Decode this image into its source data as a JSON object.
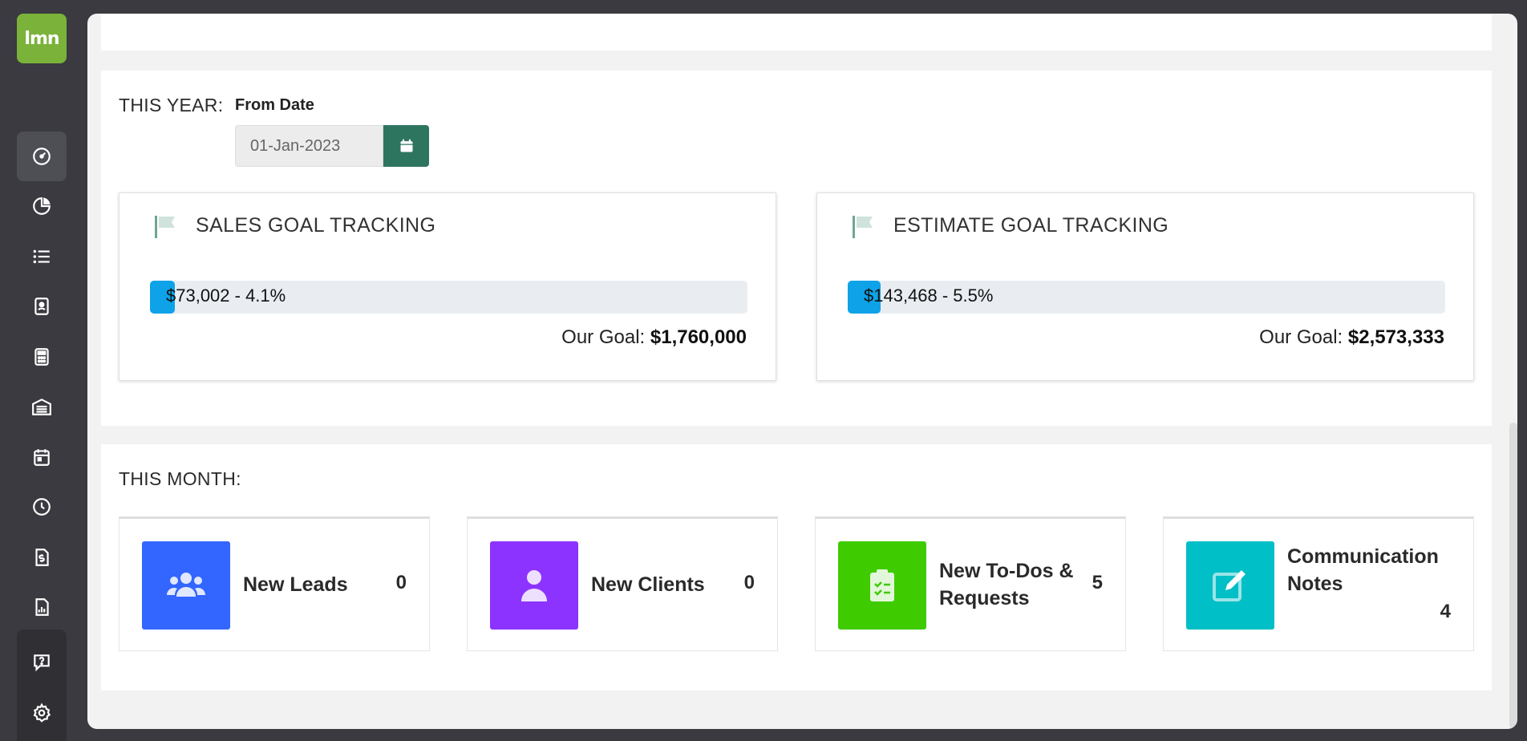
{
  "brand": {
    "logo_text": "lmn",
    "logo_color": "#7ab23a"
  },
  "sidebar": {
    "items": [
      {
        "icon": "dashboard-gauge-icon",
        "active": true
      },
      {
        "icon": "pie-chart-icon"
      },
      {
        "icon": "list-icon"
      },
      {
        "icon": "contact-card-icon"
      },
      {
        "icon": "calculator-icon"
      },
      {
        "icon": "warehouse-icon"
      },
      {
        "icon": "calendar-icon"
      },
      {
        "icon": "clock-icon"
      },
      {
        "icon": "invoice-dollar-icon"
      },
      {
        "icon": "report-chart-icon"
      },
      {
        "icon": "help-chat-icon"
      },
      {
        "icon": "settings-gear-icon"
      }
    ]
  },
  "this_year": {
    "label": "THIS YEAR:",
    "from_date_label": "From Date",
    "from_date_value": "01-Jan-2023",
    "sales": {
      "title": "SALES GOAL TRACKING",
      "progress_text": "$73,002 - 4.1%",
      "progress_fraction": 0.041,
      "goal_prefix": "Our Goal:",
      "goal_value": "$1,760,000"
    },
    "estimate": {
      "title": "ESTIMATE GOAL TRACKING",
      "progress_text": "$143,468 - 5.5%",
      "progress_fraction": 0.055,
      "goal_prefix": "Our Goal:",
      "goal_value": "$2,573,333"
    }
  },
  "this_month": {
    "label": "THIS MONTH:",
    "cards": [
      {
        "label": "New Leads",
        "value": "0",
        "icon": "users-group-icon",
        "color": "#3366ff"
      },
      {
        "label": "New Clients",
        "value": "0",
        "icon": "user-icon",
        "color": "#8c33ff"
      },
      {
        "label": "New To-Dos & Requests",
        "value": "5",
        "icon": "clipboard-check-icon",
        "color": "#3ecc00"
      },
      {
        "label": "Communication Notes",
        "value": "4",
        "icon": "edit-note-icon",
        "color": "#00bfc6"
      }
    ]
  },
  "colors": {
    "progress": "#0ea2e8",
    "date_button": "#2e7560"
  }
}
